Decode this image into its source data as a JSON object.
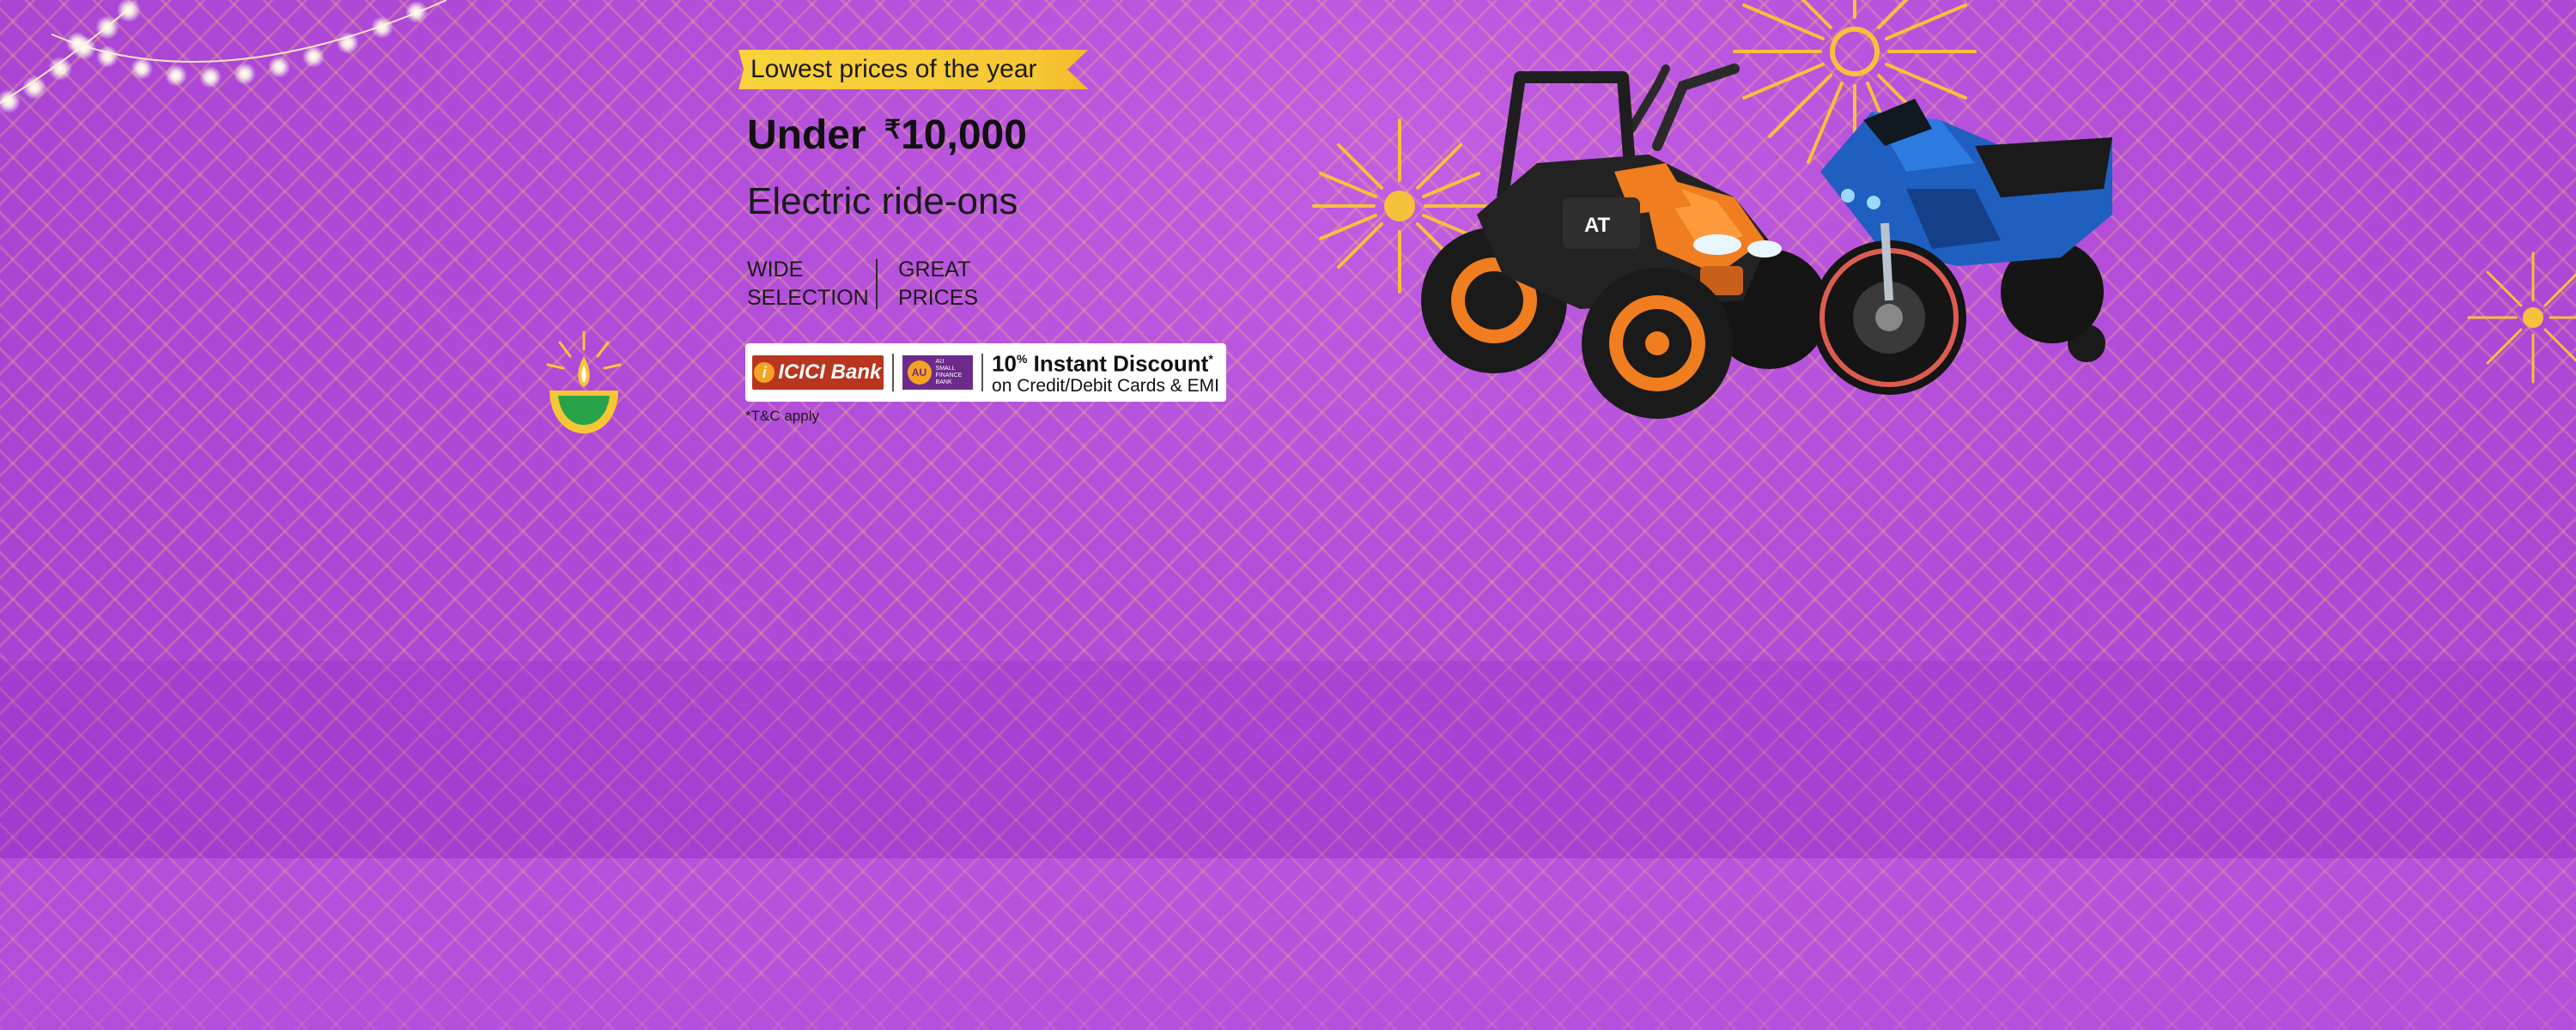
{
  "banner": {
    "tag": "Lowest prices of the year",
    "headline_prefix": "Under ",
    "headline_rupee": "₹",
    "headline_amount": "10,000",
    "subhead": "Electric ride-ons",
    "features": [
      "WIDE\nSELECTION",
      "GREAT\nPRICES"
    ],
    "offer": {
      "bank1": "ICICI Bank",
      "bank1_mark": "i",
      "bank2_badge": "AU",
      "bank2_text": "AU\nSMALL\nFINANCE\nBANK",
      "discount_value": "10",
      "discount_unit": "%",
      "discount_label": " Instant Discount",
      "discount_mark": "*",
      "discount_sub": "on Credit/Debit Cards & EMI"
    },
    "terms": "*T&C apply"
  },
  "colors": {
    "background": "#b347d9",
    "tag": "#f6c734",
    "firework": "#f3c23a",
    "atv_body": "#f07d1f",
    "bike_body": "#1f5fc0"
  },
  "icons": {
    "lights": "string-lights-icon",
    "diya": "diya-lamp-icon",
    "firework": "firework-icon"
  }
}
